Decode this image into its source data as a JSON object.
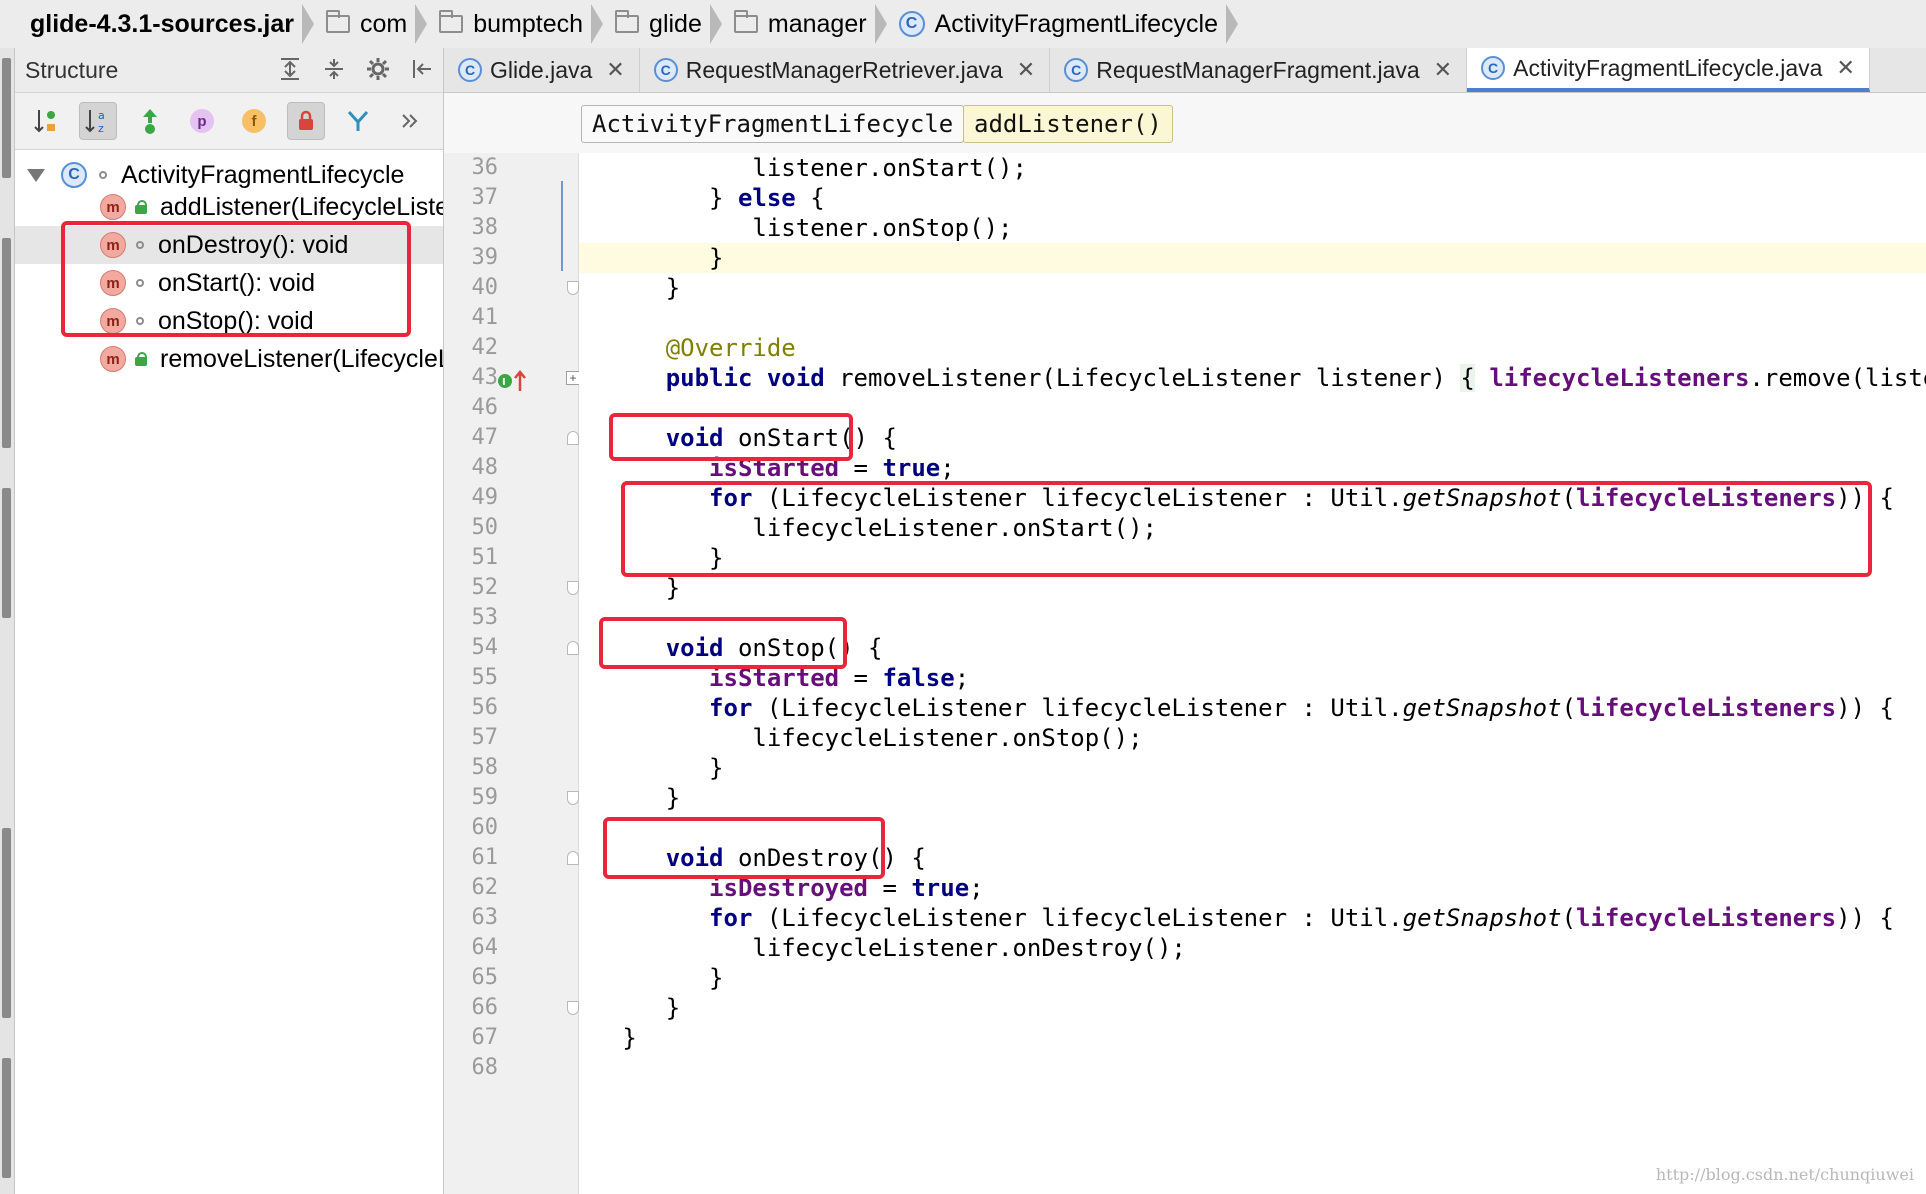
{
  "breadcrumb": [
    {
      "label": "glide-4.3.1-sources.jar",
      "icon": "jar-icon"
    },
    {
      "label": "com",
      "icon": "folder-icon"
    },
    {
      "label": "bumptech",
      "icon": "folder-icon"
    },
    {
      "label": "glide",
      "icon": "folder-icon"
    },
    {
      "label": "manager",
      "icon": "folder-icon"
    },
    {
      "label": "ActivityFragmentLifecycle",
      "icon": "class-icon",
      "icon_letter": "C"
    }
  ],
  "structure": {
    "title": "Structure",
    "tree": {
      "root": {
        "label": "ActivityFragmentLifecycle",
        "icon": "class-icon",
        "icon_letter": "C"
      },
      "items": [
        {
          "label": "addListener(LifecycleListener): void",
          "badge": "m",
          "visibility": "public"
        },
        {
          "label": "onDestroy(): void",
          "badge": "m",
          "visibility": "package"
        },
        {
          "label": "onStart(): void",
          "badge": "m",
          "visibility": "package"
        },
        {
          "label": "onStop(): void",
          "badge": "m",
          "visibility": "package"
        },
        {
          "label": "removeListener(LifecycleListener): void",
          "badge": "m",
          "visibility": "public"
        }
      ]
    },
    "toolbar_badges": {
      "p": "p",
      "f": "f"
    }
  },
  "tabs": [
    {
      "label": "Glide.java",
      "icon_letter": "C",
      "active": false
    },
    {
      "label": "RequestManagerRetriever.java",
      "icon_letter": "C",
      "active": false
    },
    {
      "label": "RequestManagerFragment.java",
      "icon_letter": "C",
      "active": false
    },
    {
      "label": "ActivityFragmentLifecycle.java",
      "icon_letter": "C",
      "active": true
    }
  ],
  "editor_breadcrumb": {
    "class": "ActivityFragmentLifecycle",
    "method": "addListener()"
  },
  "line_numbers": [
    "36",
    "37",
    "38",
    "39",
    "40",
    "41",
    "42",
    "43",
    "46",
    "47",
    "48",
    "49",
    "50",
    "51",
    "52",
    "53",
    "54",
    "55",
    "56",
    "57",
    "58",
    "59",
    "60",
    "61",
    "62",
    "63",
    "64",
    "65",
    "66",
    "67",
    "68"
  ],
  "code": {
    "l36": {
      "call": "listener.onStart();"
    },
    "l37": {
      "b1": "} ",
      "kw": "else",
      "b2": " {"
    },
    "l38": {
      "call": "listener.onStop();"
    },
    "l39": {
      "t": "}"
    },
    "l40": {
      "t": "}"
    },
    "l42": {
      "ann": "@Override"
    },
    "l43": {
      "kw1": "public",
      "kw2": "void",
      "t1": " removeListener(LifecycleListener listener) ",
      "brace": "{",
      "fld": "lifecycleListeners",
      "t2": ".remove(listener);"
    },
    "l47": {
      "kw": "void",
      "t": " onStart() {"
    },
    "l48": {
      "fld": "isStarted",
      "t": " = ",
      "kw": "true",
      "end": ";"
    },
    "l49": {
      "kw": "for",
      "t1": " (LifecycleListener lifecycleListener : Util.",
      "it": "getSnapshot",
      "t2": "(",
      "fld": "lifecycleListeners",
      "t3": ")) {"
    },
    "l50": {
      "call": "lifecycleListener.onStart();"
    },
    "l51": {
      "t": "}"
    },
    "l52": {
      "t": "}"
    },
    "l54": {
      "kw": "void",
      "t": " onStop() {"
    },
    "l55": {
      "fld": "isStarted",
      "t": " = ",
      "kw": "false",
      "end": ";"
    },
    "l56": {
      "kw": "for",
      "t1": " (LifecycleListener lifecycleListener : Util.",
      "it": "getSnapshot",
      "t2": "(",
      "fld": "lifecycleListeners",
      "t3": ")) {"
    },
    "l57": {
      "call": "lifecycleListener.onStop();"
    },
    "l58": {
      "t": "}"
    },
    "l59": {
      "t": "}"
    },
    "l61": {
      "kw": "void",
      "t": " onDestroy() {"
    },
    "l62": {
      "fld": "isDestroyed",
      "t": " = ",
      "kw": "true",
      "end": ";"
    },
    "l63": {
      "kw": "for",
      "t1": " (LifecycleListener lifecycleListener : Util.",
      "it": "getSnapshot",
      "t2": "(",
      "fld": "lifecycleListeners",
      "t3": ")) {"
    },
    "l64": {
      "call": "lifecycleListener.onDestroy();"
    },
    "l65": {
      "t": "}"
    },
    "l66": {
      "t": "}"
    },
    "l67": {
      "t": "}"
    }
  },
  "watermark": "http://blog.csdn.net/chunqiuwei",
  "colors": {
    "highlight_box": "#e8273d",
    "keyword": "#000080",
    "field": "#660e7a",
    "annotation": "#808000",
    "active_tab_underline": "#4b7fd1"
  }
}
